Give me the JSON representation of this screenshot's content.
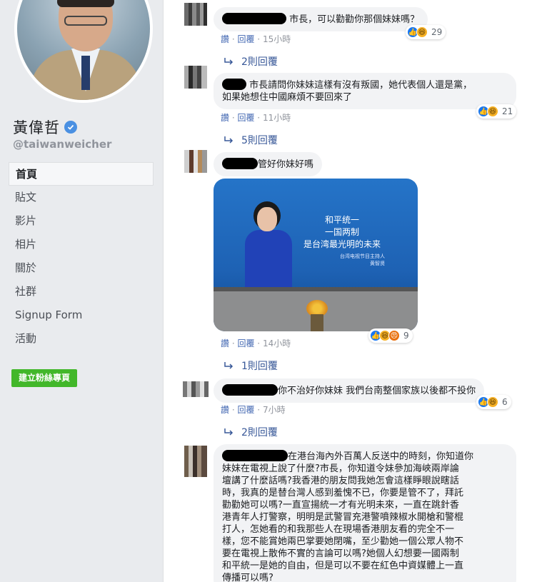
{
  "page": {
    "name": "黃偉哲",
    "handle": "@taiwanweicher",
    "nav": [
      "首頁",
      "貼文",
      "影片",
      "相片",
      "關於",
      "社群",
      "Signup Form",
      "活動"
    ],
    "active_nav": "首頁",
    "create_button": "建立粉絲專頁"
  },
  "meta_labels": {
    "like": "讚",
    "reply": "回覆",
    "dot": "·"
  },
  "comments": [
    {
      "text": "市長，可以勸勸你那個妹妹嗎？",
      "time": "15小時",
      "reactions": [
        "like",
        "haha"
      ],
      "reaction_count": "29",
      "replies": "2則回覆"
    },
    {
      "text_lines": [
        "市長請問你妹妹這樣有沒有叛國，她代表個人還是黨，",
        "如果她想住中國麻煩不要回來了"
      ],
      "time": "11小時",
      "reactions": [
        "like",
        "haha"
      ],
      "reaction_count": "21",
      "replies": "5則回覆"
    },
    {
      "text": "管好你妹好嗎",
      "time": "14小時",
      "reactions": [
        "like",
        "haha",
        "angry"
      ],
      "reaction_count": "9",
      "replies": "1則回覆",
      "image": {
        "headline": [
          "和平统一",
          "一国两制",
          "是台湾最光明的未来"
        ],
        "subtext": [
          "台湾电视节目主持人",
          "黄智贤"
        ]
      }
    },
    {
      "text": "你不治好你妹妹 我們台南整個家族以後都不投你",
      "time": "7小時",
      "reactions": [
        "like",
        "haha"
      ],
      "reaction_count": "6",
      "replies": "2則回覆"
    },
    {
      "text_lines": [
        "在港台海內外百萬人反送中的時刻，你知道你",
        "妹妹在電視上說了什麼?市長，你知道令妹參加海峽兩岸論",
        "壇講了什麼話嗎?我香港的朋友問我她怎會這樣睜眼說瞎話",
        "時，我真的是替台灣人感到羞愧不已，你要是管不了，拜託",
        "勸勸她可以嗎?一直宣揚統一才有光明未來，一直在跳針香",
        "港青年人打警察，明明是武警冒充港警噴辣椒水開槍和警棍",
        "打人，怎她看的和我那些人在現場香港朋友看的完全不一",
        "樣，您不能賞她兩巴掌要她閉嘴，至少勸她一個公眾人物不",
        "要在電視上散佈不實的言論可以嗎?她個人幻想要一國兩制",
        "和平統一是她的自由，但是可以不要在紅色中資媒體上一直",
        "傳播可以嗎?"
      ]
    }
  ]
}
